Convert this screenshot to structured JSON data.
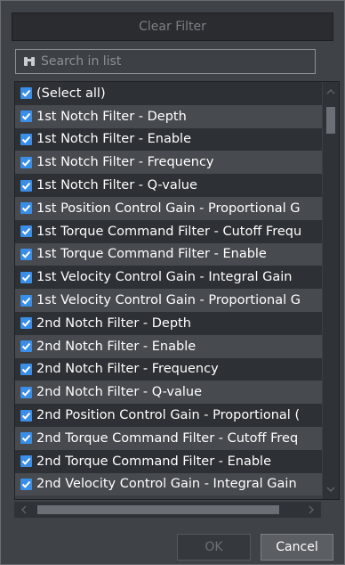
{
  "header": {
    "clear_filter_label": "Clear Filter"
  },
  "search": {
    "placeholder": "Search in list",
    "icon": "binoculars-icon"
  },
  "colors": {
    "checkbox": "#3a8ee6",
    "row_dark": "#2d3034",
    "row_light": "#474a4f",
    "background": "#3f4247"
  },
  "list": {
    "items": [
      {
        "label": "(Select all)",
        "checked": true
      },
      {
        "label": "1st Notch Filter - Depth",
        "checked": true
      },
      {
        "label": "1st Notch Filter - Enable",
        "checked": true
      },
      {
        "label": "1st Notch Filter - Frequency",
        "checked": true
      },
      {
        "label": "1st Notch Filter - Q-value",
        "checked": true
      },
      {
        "label": "1st Position Control Gain - Proportional G",
        "checked": true
      },
      {
        "label": "1st Torque Command Filter - Cutoff Frequ",
        "checked": true
      },
      {
        "label": "1st Torque Command Filter - Enable",
        "checked": true
      },
      {
        "label": "1st Velocity Control Gain - Integral Gain",
        "checked": true
      },
      {
        "label": "1st Velocity Control Gain - Proportional G",
        "checked": true
      },
      {
        "label": "2nd Notch Filter - Depth",
        "checked": true
      },
      {
        "label": "2nd Notch Filter - Enable",
        "checked": true
      },
      {
        "label": "2nd Notch Filter - Frequency",
        "checked": true
      },
      {
        "label": "2nd Notch Filter - Q-value",
        "checked": true
      },
      {
        "label": "2nd Position Control Gain - Proportional (",
        "checked": true
      },
      {
        "label": "2nd Torque Command Filter - Cutoff Freq",
        "checked": true
      },
      {
        "label": "2nd Torque Command Filter - Enable",
        "checked": true
      },
      {
        "label": "2nd Velocity Control Gain - Integral Gain",
        "checked": true
      }
    ]
  },
  "footer": {
    "ok_label": "OK",
    "cancel_label": "Cancel"
  }
}
